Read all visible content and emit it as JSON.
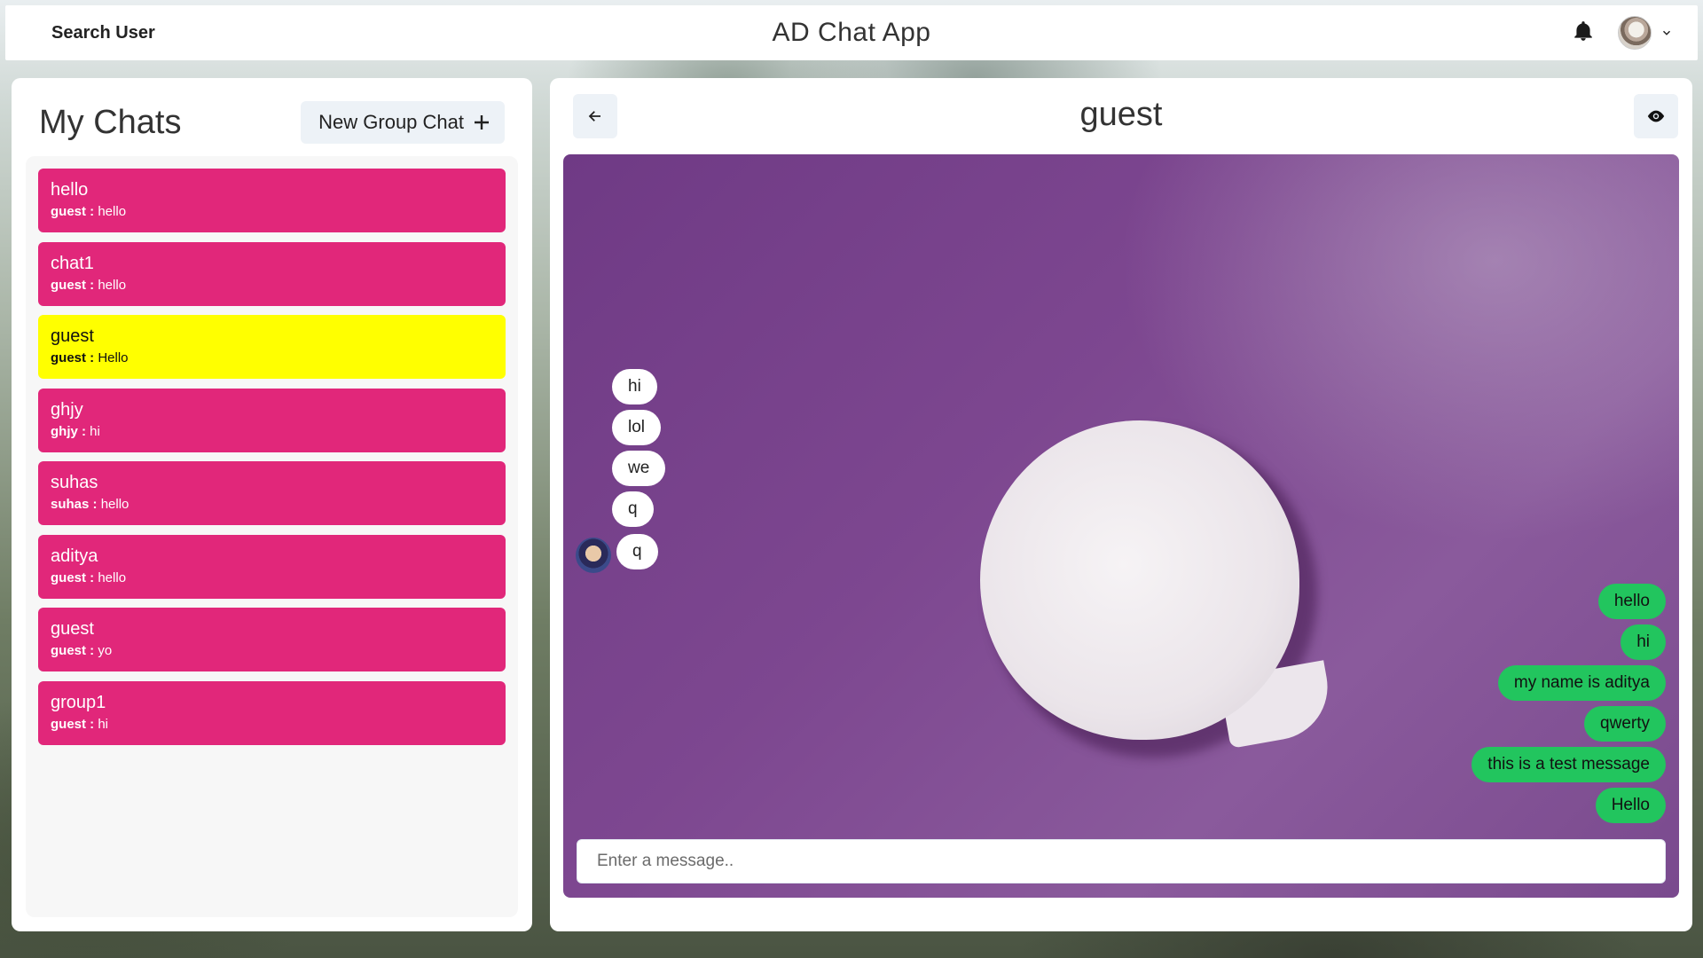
{
  "header": {
    "search_label": "Search User",
    "app_title": "AD Chat App"
  },
  "sidebar": {
    "title": "My Chats",
    "new_group_label": "New Group Chat",
    "chats": [
      {
        "name": "hello",
        "sender": "guest :",
        "latest": "hello",
        "active": false
      },
      {
        "name": "chat1",
        "sender": "guest :",
        "latest": "hello",
        "active": false
      },
      {
        "name": "guest",
        "sender": "guest :",
        "latest": "Hello",
        "active": true
      },
      {
        "name": "ghjy",
        "sender": "ghjy :",
        "latest": "hi",
        "active": false
      },
      {
        "name": "suhas",
        "sender": "suhas :",
        "latest": "hello",
        "active": false
      },
      {
        "name": "aditya",
        "sender": "guest :",
        "latest": "hello",
        "active": false
      },
      {
        "name": "guest",
        "sender": "guest :",
        "latest": "yo",
        "active": false
      },
      {
        "name": "group1",
        "sender": "guest :",
        "latest": "hi",
        "active": false
      }
    ]
  },
  "chat": {
    "title": "guest",
    "incoming": [
      "hi",
      "lol",
      "we",
      "q",
      "q"
    ],
    "outgoing": [
      "hello",
      "hi",
      "my name is aditya",
      "qwerty",
      "this is a test message",
      "Hello"
    ],
    "input_placeholder": "Enter a message.."
  },
  "colors": {
    "chat_item": "#e1277a",
    "chat_item_active": "#ffff00",
    "outgoing_bubble": "#22c55e",
    "incoming_bubble": "#ffffff"
  }
}
